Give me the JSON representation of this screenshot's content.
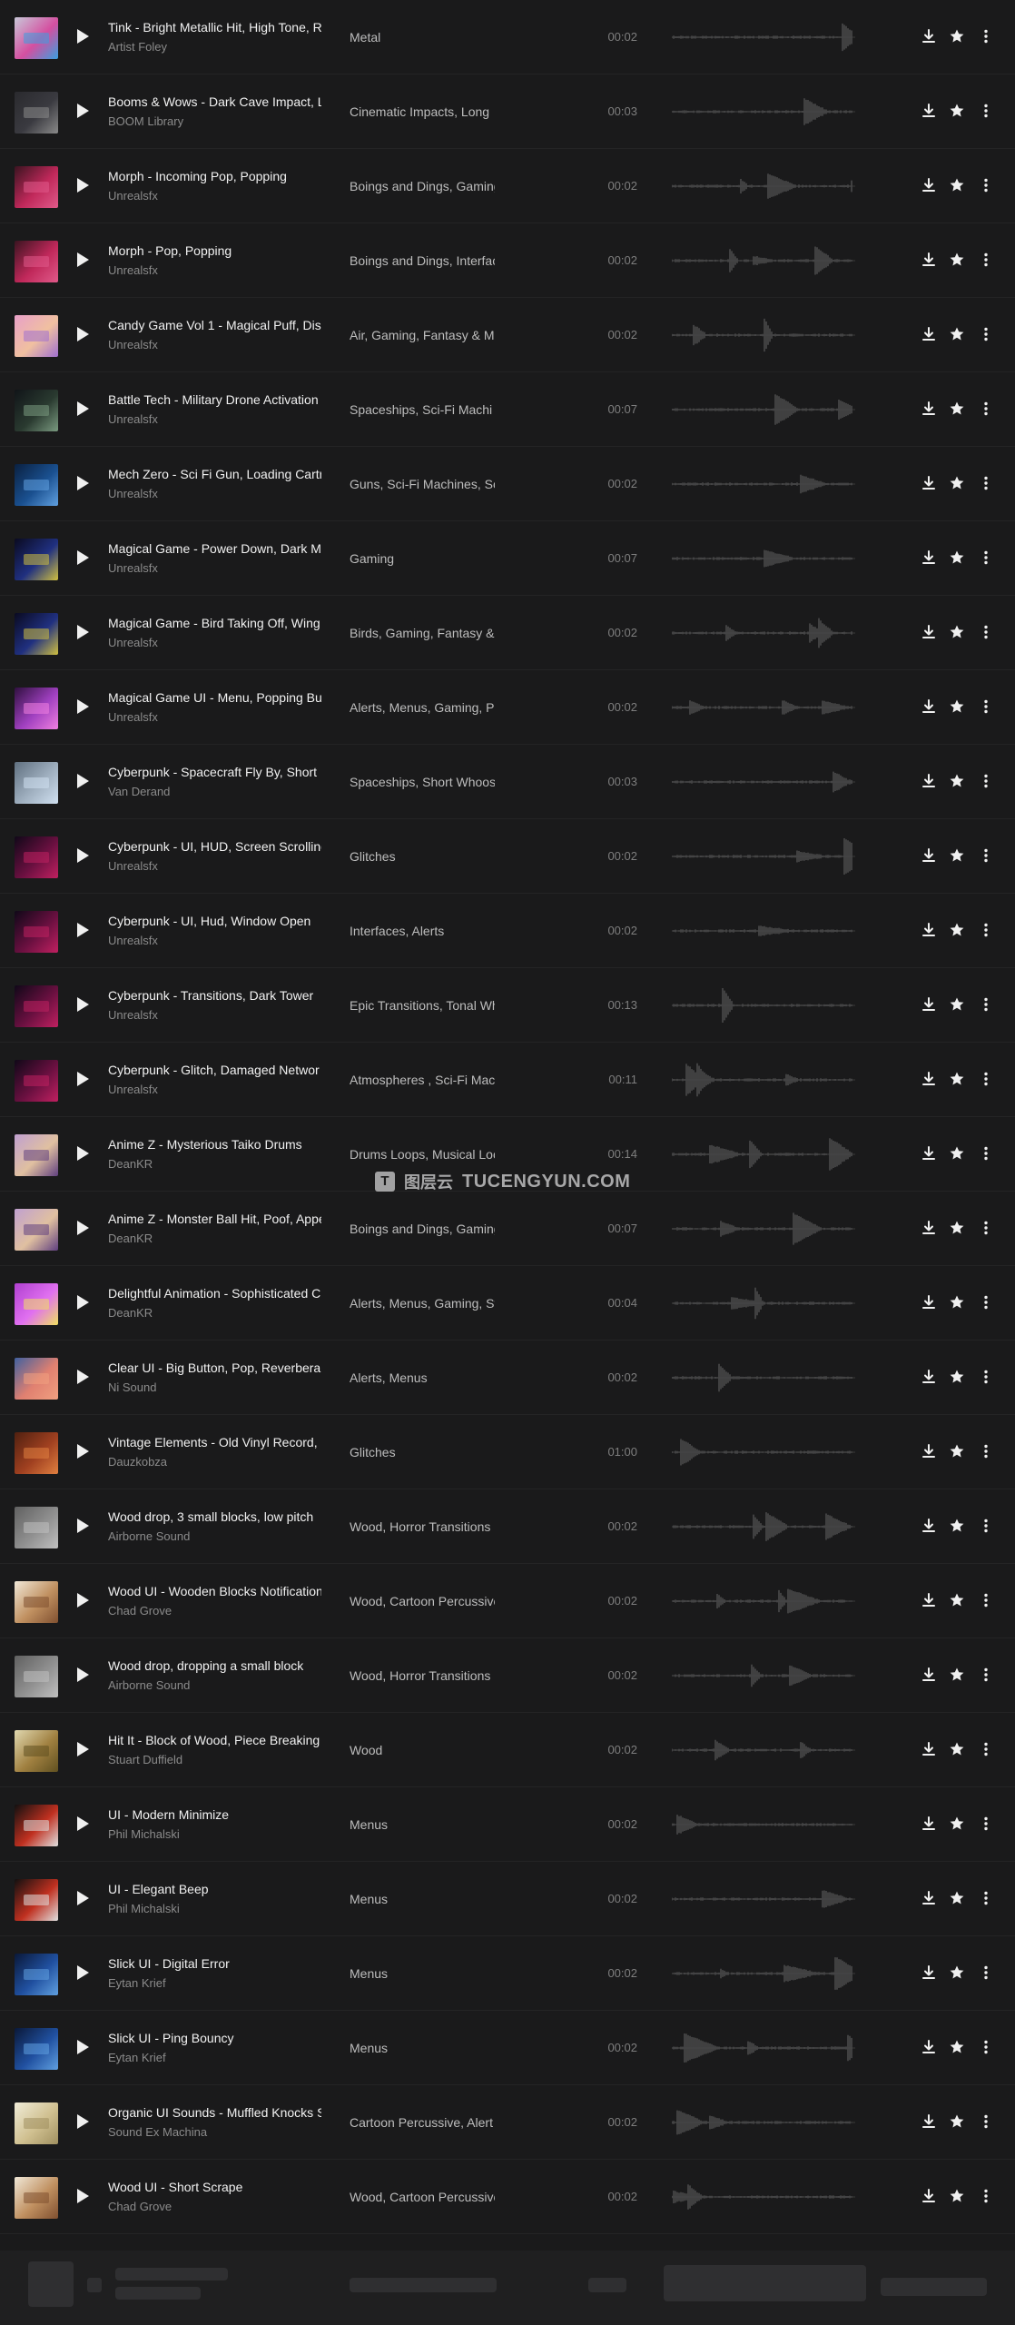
{
  "watermark": {
    "cn": "图层云",
    "en": "TUCENGYUN.COM"
  },
  "tracks": [
    {
      "title": "Tink - Bright Metallic Hit, High Tone, Re",
      "artist": "Artist Foley",
      "categories": "Metal",
      "duration": "00:02",
      "thumb": [
        "#c8c8d8",
        "#d44fa0",
        "#3aa0e0"
      ]
    },
    {
      "title": "Booms & Wows - Dark Cave Impact, L",
      "artist": "BOOM Library",
      "categories": "Cinematic Impacts, Long",
      "duration": "00:03",
      "thumb": [
        "#2a2a2e",
        "#3a3a40",
        "#8a8a8a"
      ]
    },
    {
      "title": "Morph - Incoming Pop, Popping",
      "artist": "Unrealsfx",
      "categories": "Boings and Dings, Gaming",
      "duration": "00:02",
      "thumb": [
        "#3a1420",
        "#c0285a",
        "#e05a8a"
      ]
    },
    {
      "title": "Morph - Pop, Popping",
      "artist": "Unrealsfx",
      "categories": "Boings and Dings, Interfac",
      "duration": "00:02",
      "thumb": [
        "#3a1420",
        "#c0285a",
        "#e05a8a"
      ]
    },
    {
      "title": "Candy Game Vol 1 - Magical Puff, Disa",
      "artist": "Unrealsfx",
      "categories": "Air, Gaming, Fantasy & M",
      "duration": "00:02",
      "thumb": [
        "#e8a0c8",
        "#f0c0a0",
        "#a070d0"
      ]
    },
    {
      "title": "Battle Tech - Military Drone Activation",
      "artist": "Unrealsfx",
      "categories": "Spaceships, Sci-Fi Machi",
      "duration": "00:07",
      "thumb": [
        "#101418",
        "#2a3a30",
        "#7a9a80"
      ]
    },
    {
      "title": "Mech Zero - Sci Fi Gun, Loading Cartr",
      "artist": "Unrealsfx",
      "categories": "Guns, Sci-Fi Machines, Sc",
      "duration": "00:02",
      "thumb": [
        "#0a2040",
        "#1a5090",
        "#60a0e0"
      ]
    },
    {
      "title": "Magical Game - Power Down, Dark My",
      "artist": "Unrealsfx",
      "categories": "Gaming",
      "duration": "00:07",
      "thumb": [
        "#0a0a20",
        "#203080",
        "#d0c040"
      ]
    },
    {
      "title": "Magical Game - Bird Taking Off, Wing",
      "artist": "Unrealsfx",
      "categories": "Birds, Gaming, Fantasy &",
      "duration": "00:02",
      "thumb": [
        "#0a0a20",
        "#203080",
        "#d0c040"
      ]
    },
    {
      "title": "Magical Game UI - Menu, Popping But",
      "artist": "Unrealsfx",
      "categories": "Alerts, Menus, Gaming, Po",
      "duration": "00:02",
      "thumb": [
        "#301040",
        "#a040c0",
        "#f080e0"
      ]
    },
    {
      "title": "Cyberpunk - Spacecraft Fly By, Short",
      "artist": "Van Derand",
      "categories": "Spaceships, Short Whoos",
      "duration": "00:03",
      "thumb": [
        "#607080",
        "#a0b0c0",
        "#d0e0f0"
      ]
    },
    {
      "title": "Cyberpunk - UI, HUD, Screen Scrolling",
      "artist": "Unrealsfx",
      "categories": "Glitches",
      "duration": "00:02",
      "thumb": [
        "#100818",
        "#6a1040",
        "#c02060"
      ]
    },
    {
      "title": "Cyberpunk - UI, Hud, Window Open",
      "artist": "Unrealsfx",
      "categories": "Interfaces, Alerts",
      "duration": "00:02",
      "thumb": [
        "#100818",
        "#6a1040",
        "#c02060"
      ]
    },
    {
      "title": "Cyberpunk - Transitions, Dark Tower",
      "artist": "Unrealsfx",
      "categories": "Epic Transitions, Tonal Wh",
      "duration": "00:13",
      "thumb": [
        "#100818",
        "#6a1040",
        "#c02060"
      ]
    },
    {
      "title": "Cyberpunk - Glitch, Damaged Networ",
      "artist": "Unrealsfx",
      "categories": "Atmospheres , Sci-Fi Mac",
      "duration": "00:11",
      "thumb": [
        "#100818",
        "#6a1040",
        "#c02060"
      ]
    },
    {
      "title": "Anime Z - Mysterious Taiko Drums",
      "artist": "DeanKR",
      "categories": "Drums Loops, Musical Loo",
      "duration": "00:14",
      "thumb": [
        "#c0a0d0",
        "#e0c0a0",
        "#604080"
      ]
    },
    {
      "title": "Anime Z - Monster Ball Hit, Poof, Appe",
      "artist": "DeanKR",
      "categories": "Boings and Dings, Gaming",
      "duration": "00:07",
      "thumb": [
        "#c0a0d0",
        "#e0c0a0",
        "#604080"
      ]
    },
    {
      "title": "Delightful Animation - Sophisticated C",
      "artist": "DeanKR",
      "categories": "Alerts, Menus, Gaming, St",
      "duration": "00:04",
      "thumb": [
        "#b040d0",
        "#e070f0",
        "#f0e060"
      ]
    },
    {
      "title": "Clear UI - Big Button, Pop, Reverberan",
      "artist": "Ni Sound",
      "categories": "Alerts, Menus",
      "duration": "00:02",
      "thumb": [
        "#4060a0",
        "#e08070",
        "#f0a080"
      ]
    },
    {
      "title": "Vintage Elements - Old Vinyl Record, C",
      "artist": "Dauzkobza",
      "categories": "Glitches",
      "duration": "01:00",
      "thumb": [
        "#502010",
        "#a04020",
        "#e08040"
      ]
    },
    {
      "title": "Wood drop, 3 small blocks, low pitch",
      "artist": "Airborne Sound",
      "categories": "Wood, Horror Transitions",
      "duration": "00:02",
      "thumb": [
        "#606060",
        "#909090",
        "#c0c0c0"
      ]
    },
    {
      "title": "Wood UI - Wooden Blocks Notification",
      "artist": "Chad Grove",
      "categories": "Wood, Cartoon Percussive",
      "duration": "00:02",
      "thumb": [
        "#f0e8d8",
        "#c09060",
        "#805030"
      ]
    },
    {
      "title": "Wood drop, dropping a small block",
      "artist": "Airborne Sound",
      "categories": "Wood, Horror Transitions",
      "duration": "00:02",
      "thumb": [
        "#606060",
        "#909090",
        "#c0c0c0"
      ]
    },
    {
      "title": "Hit It - Block of Wood, Piece Breaking",
      "artist": "Stuart Duffield",
      "categories": "Wood",
      "duration": "00:02",
      "thumb": [
        "#e0d8b0",
        "#a08040",
        "#605020"
      ]
    },
    {
      "title": "UI - Modern Minimize",
      "artist": "Phil Michalski",
      "categories": "Menus",
      "duration": "00:02",
      "thumb": [
        "#101010",
        "#c03020",
        "#e0e0e0"
      ]
    },
    {
      "title": "UI - Elegant Beep",
      "artist": "Phil Michalski",
      "categories": "Menus",
      "duration": "00:02",
      "thumb": [
        "#101010",
        "#c03020",
        "#e0e0e0"
      ]
    },
    {
      "title": "Slick UI - Digital Error",
      "artist": "Eytan Krief",
      "categories": "Menus",
      "duration": "00:02",
      "thumb": [
        "#0a1838",
        "#2050a0",
        "#60a0e0"
      ]
    },
    {
      "title": "Slick UI - Ping Bouncy",
      "artist": "Eytan Krief",
      "categories": "Menus",
      "duration": "00:02",
      "thumb": [
        "#0a1838",
        "#2050a0",
        "#60a0e0"
      ]
    },
    {
      "title": "Organic UI Sounds - Muffled Knocks S",
      "artist": "Sound Ex Machina",
      "categories": "Cartoon Percussive, Alert",
      "duration": "00:02",
      "thumb": [
        "#f0ecd8",
        "#d0c090",
        "#a09060"
      ]
    },
    {
      "title": "Wood UI - Short Scrape",
      "artist": "Chad Grove",
      "categories": "Wood, Cartoon Percussive",
      "duration": "00:02",
      "thumb": [
        "#f0e8d8",
        "#c09060",
        "#805030"
      ]
    }
  ]
}
